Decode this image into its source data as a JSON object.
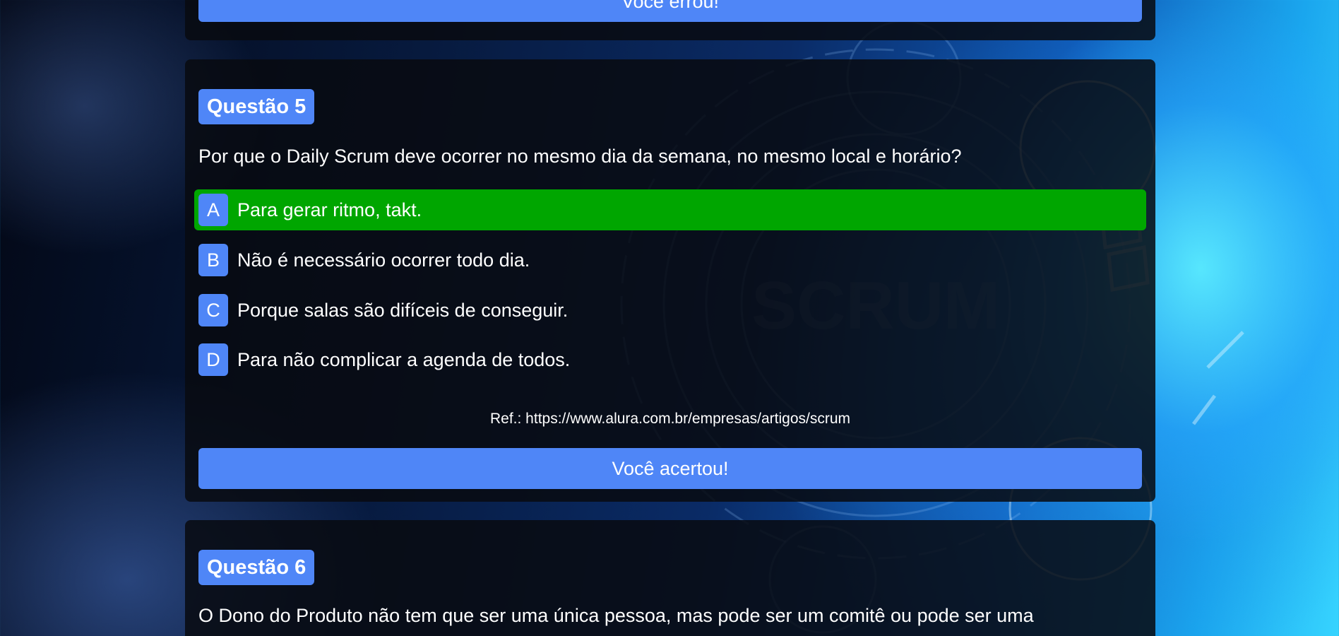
{
  "previous_question": {
    "result_label": "Você errou!"
  },
  "question5": {
    "title": "Questão 5",
    "text": "Por que o Daily Scrum deve ocorrer no mesmo dia da semana, no mesmo local e horário?",
    "options": [
      {
        "letter": "A",
        "text": "Para gerar ritmo, takt.",
        "state": "correct"
      },
      {
        "letter": "B",
        "text": "Não é necessário ocorrer todo dia."
      },
      {
        "letter": "C",
        "text": "Porque salas são difíceis de conseguir."
      },
      {
        "letter": "D",
        "text": "Para não complicar a agenda de todos."
      }
    ],
    "reference": "Ref.: https://www.alura.com.br/empresas/artigos/scrum",
    "result_label": "Você acertou!"
  },
  "question6": {
    "title": "Questão 6",
    "text": "O Dono do Produto não tem que ser uma única pessoa, mas pode ser um comitê ou pode ser uma"
  },
  "background": {
    "watermark_text": "SCRUM"
  },
  "colors": {
    "accent_blue": "#4f86f7",
    "correct_green": "#00a600",
    "card_background": "rgba(8,10,16,0.86)"
  }
}
